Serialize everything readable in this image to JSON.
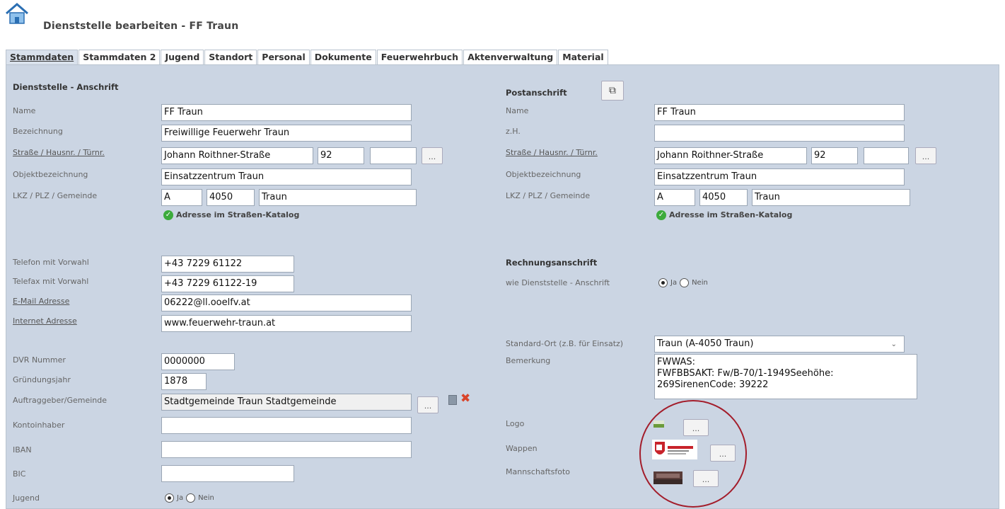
{
  "header": {
    "title": "Dienststelle bearbeiten - FF Traun",
    "icon": "home-icon"
  },
  "tabs": [
    "Stammdaten",
    "Stammdaten 2",
    "Jugend",
    "Standort",
    "Personal",
    "Dokumente",
    "Feuerwehrbuch",
    "Aktenverwaltung",
    "Material"
  ],
  "left": {
    "section_title": "Dienststelle - Anschrift",
    "name_label": "Name",
    "name_value": "FF Traun",
    "bezeichnung_label": "Bezeichnung",
    "bezeichnung_value": "Freiwillige Feuerwehr Traun",
    "strasse_label": "Straße / Hausnr. / Türnr.",
    "strasse_value": "Johann Roithner-Straße",
    "hausnr_value": "92",
    "tuernr_value": "",
    "objekt_label": "Objektbezeichnung",
    "objekt_value": "Einsatzzentrum Traun",
    "lkz_label": "LKZ / PLZ / Gemeinde",
    "lkz_value": "A",
    "plz_value": "4050",
    "gemeinde_value": "Traun",
    "catalog_text": "Adresse im Straßen-Katalog",
    "telefon_label": "Telefon mit Vorwahl",
    "telefon_value": "+43 7229 61122",
    "telefax_label": "Telefax mit Vorwahl",
    "telefax_value": "+43 7229 61122-19",
    "email_label": "E-Mail Adresse",
    "email_value": "06222@ll.ooelfv.at",
    "internet_label": "Internet Adresse",
    "internet_value": "www.feuerwehr-traun.at",
    "dvr_label": "DVR Nummer",
    "dvr_value": "0000000",
    "gruendung_label": "Gründungsjahr",
    "gruendung_value": "1878",
    "auftraggeber_label": "Auftraggeber/Gemeinde",
    "auftraggeber_value": "Stadtgemeinde Traun Stadtgemeinde",
    "kontoinhaber_label": "Kontoinhaber",
    "kontoinhaber_value": "",
    "iban_label": "IBAN",
    "iban_value": "",
    "bic_label": "BIC",
    "bic_value": "",
    "jugend_label": "Jugend",
    "jugend_ja": "Ja",
    "jugend_nein": "Nein",
    "jugend_selected": "Ja"
  },
  "right": {
    "post_title": "Postanschrift",
    "name_label": "Name",
    "name_value": "FF Traun",
    "zh_label": "z.H.",
    "zh_value": "",
    "strasse_label": "Straße / Hausnr. / Türnr.",
    "strasse_value": "Johann Roithner-Straße",
    "hausnr_value": "92",
    "tuernr_value": "",
    "objekt_label": "Objektbezeichnung",
    "objekt_value": "Einsatzzentrum Traun",
    "lkz_label": "LKZ / PLZ / Gemeinde",
    "lkz_value": "A",
    "plz_value": "4050",
    "gemeinde_value": "Traun",
    "catalog_text": "Adresse im Straßen-Katalog",
    "rechnung_title": "Rechnungsanschrift",
    "wie_label": "wie Dienststelle - Anschrift",
    "wie_ja": "Ja",
    "wie_nein": "Nein",
    "wie_selected": "Ja",
    "standard_label": "Standard-Ort (z.B. für Einsatz)",
    "standard_value": "Traun (A-4050 Traun)",
    "bemerkung_label": "Bemerkung",
    "bemerkung_line1": "FWWAS:",
    "bemerkung_line2": "FWFBBSAKT: Fw/B-70/1-1949Seehöhe:",
    "bemerkung_line3": "269SirenenCode: 39222",
    "logo_label": "Logo",
    "wappen_label": "Wappen",
    "foto_label": "Mannschaftsfoto"
  },
  "ellipsis": "...",
  "colors": {
    "panel": "#cbd5e3",
    "highlight_circle": "#a31d2b",
    "check": "#3cab3c",
    "delete": "#d9442a"
  }
}
